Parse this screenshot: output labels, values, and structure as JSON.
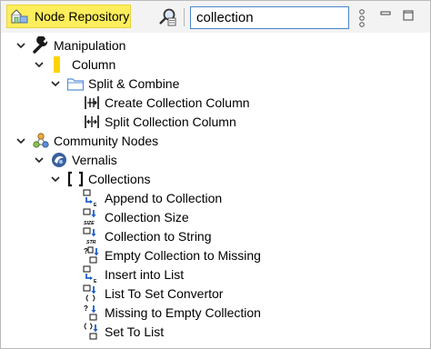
{
  "header": {
    "tab_label": "Node Repository",
    "search_value": "collection"
  },
  "tree": {
    "manipulation": "Manipulation",
    "column": "Column",
    "split_combine": "Split & Combine",
    "create_collection_column": "Create Collection Column",
    "split_collection_column": "Split Collection Column",
    "community_nodes": "Community Nodes",
    "vernalis": "Vernalis",
    "collections": "Collections",
    "leaves": [
      {
        "label": "Append to Collection",
        "icon": "append-to-collection-icon"
      },
      {
        "label": "Collection Size",
        "icon": "collection-size-icon"
      },
      {
        "label": "Collection to String",
        "icon": "collection-to-string-icon"
      },
      {
        "label": "Empty Collection to Missing",
        "icon": "empty-to-missing-icon"
      },
      {
        "label": "Insert into List",
        "icon": "insert-into-list-icon"
      },
      {
        "label": "List To Set Convertor",
        "icon": "list-to-set-icon"
      },
      {
        "label": "Missing to Empty Collection",
        "icon": "missing-to-empty-icon"
      },
      {
        "label": "Set To List",
        "icon": "set-to-list-icon"
      }
    ],
    "icon_labels": {
      "size": "SIZE",
      "str": "STR",
      "e": "E",
      "q": "?"
    }
  },
  "colors": {
    "tab_bg": "#ffee5c",
    "search_border": "#4a86c7",
    "blue_arrow": "#1f5fd1",
    "column_yellow": "#ffd400",
    "folder_blue": "#5b8fd8"
  }
}
